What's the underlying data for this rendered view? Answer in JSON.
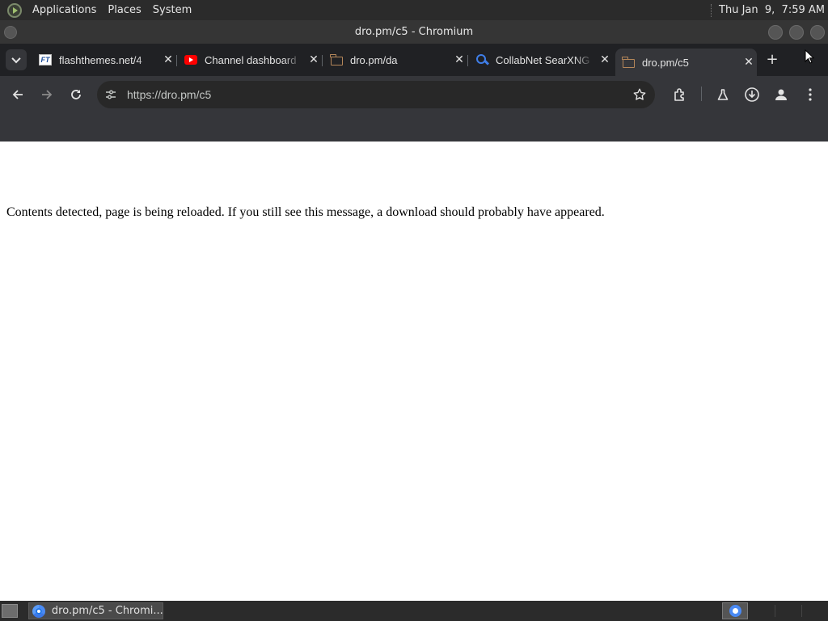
{
  "top_panel": {
    "menus": [
      "Applications",
      "Places",
      "System"
    ],
    "clock": "Thu Jan  9,  7:59 AM"
  },
  "window": {
    "title": "dro.pm/c5 - Chromium"
  },
  "tabs": [
    {
      "label": "flashthemes.net/4",
      "favicon": "flashthemes-favicon",
      "active": false
    },
    {
      "label": "Channel dashboard",
      "favicon": "youtube-favicon",
      "active": false
    },
    {
      "label": "dro.pm/da",
      "favicon": "folder-favicon",
      "active": false
    },
    {
      "label": "CollabNet SearXNG",
      "favicon": "search-favicon",
      "active": false
    },
    {
      "label": "dro.pm/c5",
      "favicon": "folder-favicon",
      "active": true
    }
  ],
  "toolbar": {
    "url": "https://dro.pm/c5",
    "icons": [
      "back-icon",
      "forward-icon",
      "reload-icon",
      "site-settings-icon",
      "bookmark-star-icon",
      "extensions-icon",
      "labs-flask-icon",
      "downloads-icon",
      "profile-icon",
      "menu-kebab-icon"
    ]
  },
  "page": {
    "message": "Contents detected, page is being reloaded. If you still see this message, a download should probably have appeared."
  },
  "taskbar": {
    "task_label": "dro.pm/c5 - Chromi..."
  },
  "colors": {
    "tab_strip_bg": "#202124",
    "toolbar_bg": "#35363a",
    "omnibox_bg": "#282828",
    "panel_bg": "#2b2b2b",
    "youtube_red": "#ff0000",
    "search_blue": "#3f7ee8"
  }
}
